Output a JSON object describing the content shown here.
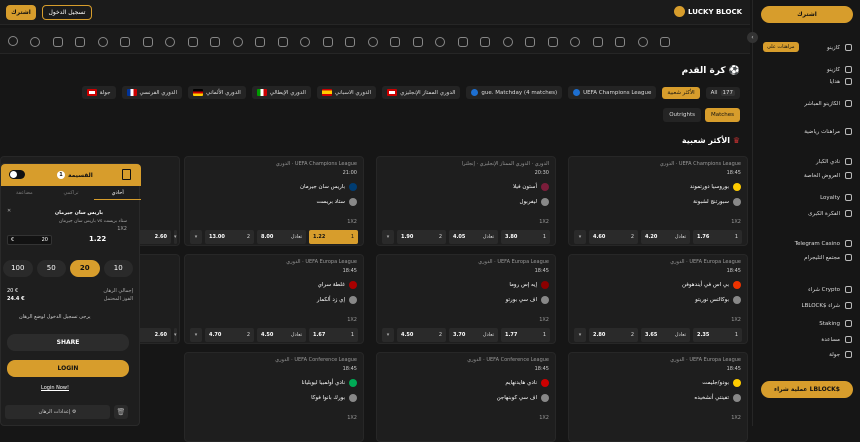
{
  "header": {
    "logo": "LUCKY BLOCK",
    "register": "اشترك",
    "login": "تسجيل الدخول"
  },
  "colors": {
    "accent": "#d79d2c",
    "bg": "#161616"
  },
  "main": {
    "title": "كرة القدم",
    "filters": [
      "All",
      "177",
      "الأكثر شعبية",
      "UEFA Champions League",
      "gue. Matchday (4 matches)",
      "الدوري الممتاز الإنجليزي",
      "الدوري الاسباني",
      "الدوري الإيطالي",
      "الدوري الألماني",
      "الدوري الفرنسي",
      "جولة"
    ],
    "tabs": [
      "Matches",
      "Outrights"
    ],
    "section": "الأكثر شعبية"
  },
  "cards": [
    {
      "league": "الدوري · UEFA Champions League",
      "time": "18:45",
      "home": "بوروسيا دورتموند",
      "away": "سبورتنج لشبونة",
      "market": "1X2",
      "odds": [
        [
          "1",
          "1.76"
        ],
        [
          "تعادل",
          "4.20"
        ],
        [
          "2",
          "4.60"
        ]
      ]
    },
    {
      "league": "الدوري · الدوري الممتاز الإنجليزي · إنجلترا",
      "time": "20:30",
      "home": "أستون فيلا",
      "away": "ليفربول",
      "market": "1X2",
      "odds": [
        [
          "1",
          "3.80"
        ],
        [
          "تعادل",
          "4.05"
        ],
        [
          "2",
          "1.90"
        ]
      ]
    },
    {
      "league": "الدوري · UEFA Champions League",
      "time": "21:00",
      "home": "باريس سان جيرمان",
      "away": "ستاد بريست",
      "market": "1X2",
      "odds": [
        [
          "1",
          "1.22"
        ],
        [
          "تعادل",
          "8.00"
        ],
        [
          "2",
          "13.00"
        ]
      ]
    },
    {
      "league": "الدوري · UEFA Europa League",
      "time": "18:45",
      "home": "بي اس في أيندهوفن",
      "away": "بوكالتس نوريتو",
      "market": "1X2",
      "odds": [
        [
          "1",
          "2.35"
        ],
        [
          "تعادل",
          "3.65"
        ],
        [
          "2",
          "2.80"
        ]
      ]
    },
    {
      "league": "الدوري · UEFA Europa League",
      "time": "18:45",
      "home": "إيه إس روما",
      "away": "اف سي بورتو",
      "market": "1X2",
      "odds": [
        [
          "1",
          "1.77"
        ],
        [
          "تعادل",
          "3.70"
        ],
        [
          "2",
          "4.50"
        ]
      ]
    },
    {
      "league": "الدوري · UEFA Europa League",
      "time": "18:45",
      "home": "غلطة سراي",
      "away": "إي زد ألكمار",
      "market": "1X2",
      "odds": [
        [
          "1",
          "1.67"
        ],
        [
          "تعادل",
          "4.50"
        ],
        [
          "2",
          "4.70"
        ]
      ]
    },
    {
      "league": "الدوري · UEFA Europa League",
      "time": "18:45",
      "home": "بودو/جليمت",
      "away": "تفينتي أنشخيده",
      "market": "1X2"
    },
    {
      "league": "الدوري · UEFA Conference League",
      "time": "18:45",
      "home": "نادي هايدنهايم",
      "away": "اف سي كوبنهاجن",
      "market": "1X2"
    },
    {
      "league": "الدوري · UEFA Conference League",
      "time": "18:45",
      "home": "نادي أولمبيا ليوبليانا",
      "away": "بورك بانوا فوكا",
      "market": "1X2"
    }
  ],
  "partial_cards": {
    "odds1": "2.60",
    "odds2": "2.60"
  },
  "slip": {
    "title": "القسيمة",
    "count": "1",
    "tabs": [
      "أحادي",
      "تراكمي",
      "مضاعفة"
    ],
    "team": "باريس سان جيرمان",
    "match": "باريس سان جيرمان vs ستاد بريست",
    "market": "1X2",
    "odd": "1.22",
    "stake": "20",
    "currency": "€",
    "quick": [
      "10",
      "20",
      "50",
      "100"
    ],
    "total_label": "إجمالي الرهان",
    "total": "20 €",
    "win_label": "الفوز المحتمل",
    "win": "24.4 €",
    "login_note": "يرجى تسجيل الدخول لوضع الرهان",
    "share": "SHARE",
    "login": "LOGIN",
    "account_note": "Login Now!",
    "settings": "إعدادات الرهان"
  },
  "sidebar": {
    "register": "اشترك",
    "items": [
      "كازينو",
      "كازينو",
      "هدايا",
      "الكازينو المباشر",
      "مراهنات رياضية",
      "نادي الكبار",
      "العروض الخاصة",
      "Loyalty",
      "الفكرة الكبرى",
      "Telegram Casino",
      "مجتمع التليجرام",
      "شراء Crypto",
      "LBLOCK$ شراء",
      "Staking",
      "مساعدة",
      "جولة"
    ],
    "promo": "مراهنات على",
    "buy": "عملية شراء LBLOCK$"
  }
}
